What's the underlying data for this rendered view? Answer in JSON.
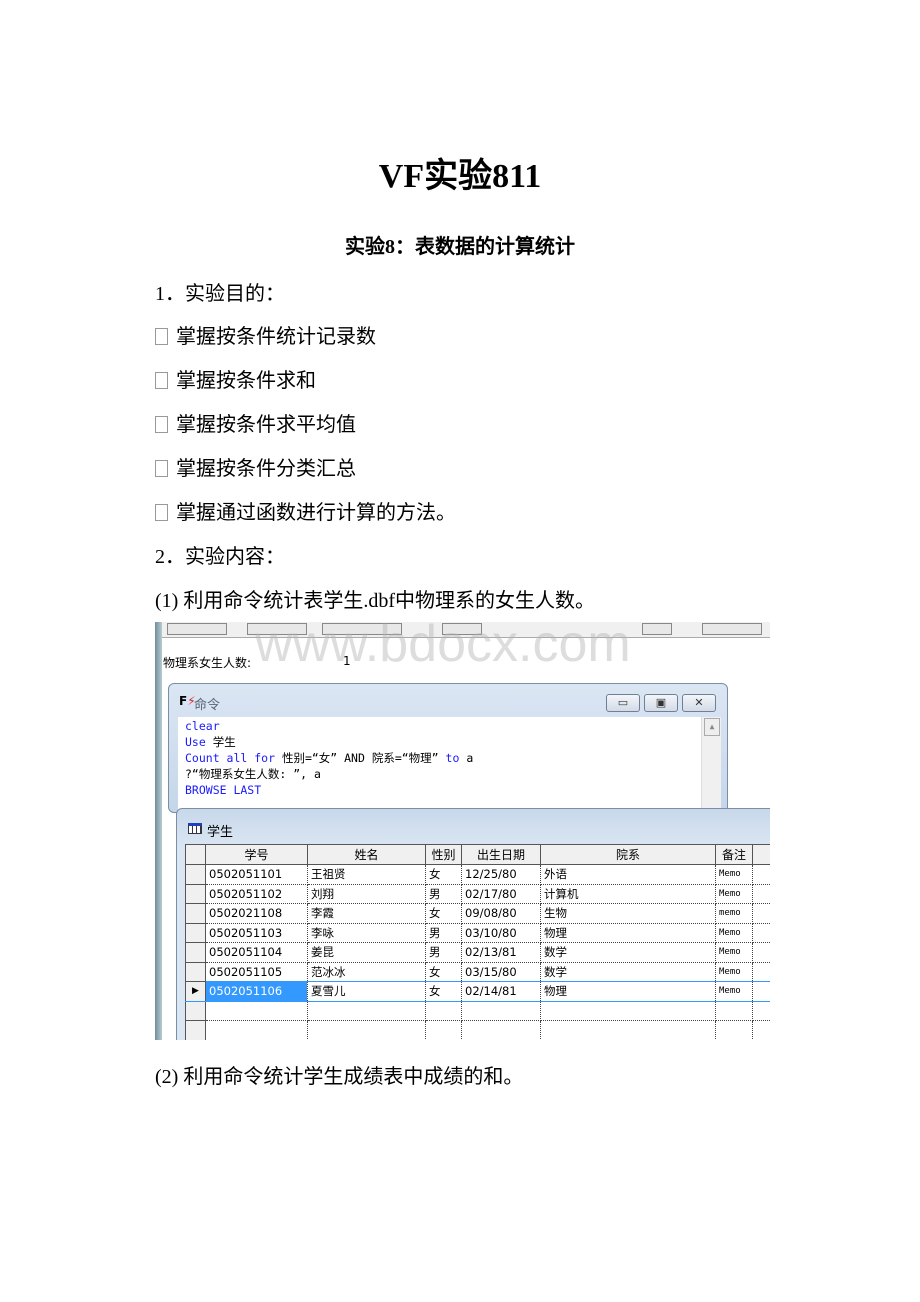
{
  "doc": {
    "title": "VF实验811",
    "subtitle": "实验8：表数据的计算统计",
    "section1": "1．实验目的：",
    "bullets": [
      "掌握按条件统计记录数",
      "掌握按条件求和",
      "掌握按条件求平均值",
      "掌握按条件分类汇总",
      "掌握通过函数进行计算的方法。"
    ],
    "section2": "2．实验内容：",
    "item1": "(1) 利用命令统计表学生.dbf中物理系的女生人数。",
    "item2": "(2) 利用命令统计学生成绩表中成绩的和。",
    "watermark": "www.bdocx.com"
  },
  "screenshot": {
    "output_label": "物理系女生人数:",
    "output_value": "1",
    "cmd_window": {
      "title": "命令",
      "min": "▭",
      "max": "▣",
      "close": "✕",
      "lines": [
        [
          {
            "t": "clear",
            "kw": true
          }
        ],
        [
          {
            "t": "Use",
            "kw": true
          },
          {
            "t": " 学生",
            "kw": false
          }
        ],
        [
          {
            "t": "Count all for",
            "kw": true
          },
          {
            "t": " 性别=“女” AND 院系=“物理” ",
            "kw": false
          },
          {
            "t": "to",
            "kw": true
          },
          {
            "t": " a",
            "kw": false
          }
        ],
        [
          {
            "t": "?“物理系女生人数: ”, a",
            "kw": false
          }
        ],
        [
          {
            "t": "BROWSE LAST",
            "kw": true
          }
        ]
      ]
    },
    "table_window": {
      "title": "学生",
      "columns": [
        "学号",
        "姓名",
        "性别",
        "出生日期",
        "院系",
        "备注"
      ],
      "rows": [
        [
          "0502051101",
          "王祖贤",
          "女",
          "12/25/80",
          "外语",
          "Memo"
        ],
        [
          "0502051102",
          "刘翔",
          "男",
          "02/17/80",
          "计算机",
          "Memo"
        ],
        [
          "0502021108",
          "李霞",
          "女",
          "09/08/80",
          "生物",
          "memo"
        ],
        [
          "0502051103",
          "李咏",
          "男",
          "03/10/80",
          "物理",
          "Memo"
        ],
        [
          "0502051104",
          "姜昆",
          "男",
          "02/13/81",
          "数学",
          "Memo"
        ],
        [
          "0502051105",
          "范冰冰",
          "女",
          "03/15/80",
          "数学",
          "Memo"
        ],
        [
          "0502051106",
          "夏雪儿",
          "女",
          "02/14/81",
          "物理",
          "Memo"
        ]
      ],
      "selected_row": 6,
      "selected_color": "#3399ff"
    }
  }
}
